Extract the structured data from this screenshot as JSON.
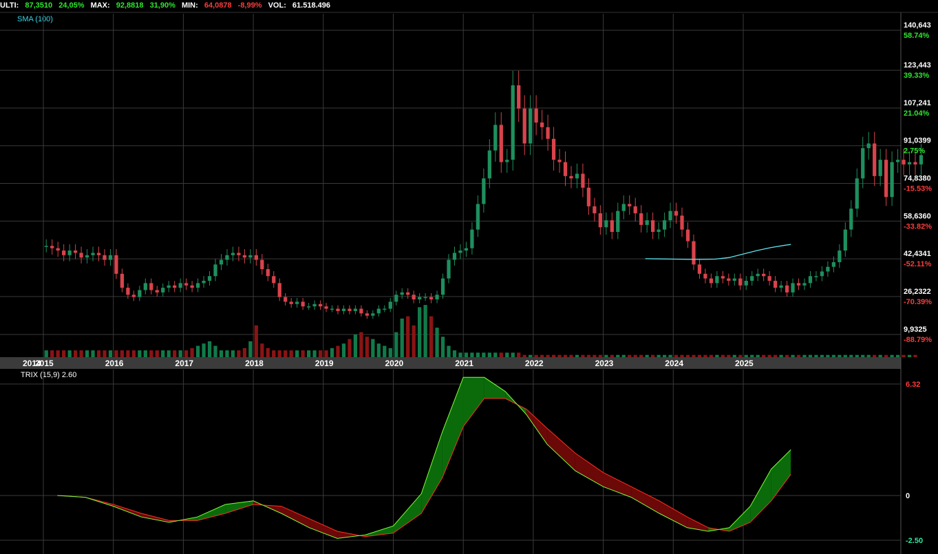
{
  "header": {
    "last_label": "ULTI:",
    "last_value": "87,3510",
    "last_pct": "24,05%",
    "max_label": "MAX:",
    "max_value": "92,8818",
    "max_pct": "31,90%",
    "min_label": "MIN:",
    "min_value": "64,0878",
    "min_pct": "-8,99%",
    "vol_label": "VOL:",
    "vol_value": "61.518.496"
  },
  "sma_label": "SMA (100)",
  "trix_label": "TRIX (15,9) 2.60",
  "colors": {
    "up": "#1e8f5e",
    "down": "#d9434b",
    "sma": "#5fe4f0",
    "trix": "#7dff3a",
    "signal": "#ff3020",
    "fill_up": "#0b6b0b",
    "fill_down": "#6b0808",
    "grid": "#3a3a3a"
  },
  "chart_data": [
    {
      "type": "candlestick",
      "title": "",
      "y_axis": {
        "ticks": [
          "140,643",
          "123,443",
          "107,241",
          "91,0399",
          "74,8380",
          "58,6360",
          "42,4341",
          "26,2322",
          "9,9325"
        ],
        "tick_values": [
          140.643,
          123.443,
          107.241,
          91.0399,
          74.838,
          58.636,
          42.4341,
          26.2322,
          9.9325
        ],
        "pct_labels": [
          "58.74%",
          "39.33%",
          "21.04%",
          "2.75%",
          "-15.53%",
          "-33.82%",
          "-52.11%",
          "-70.39%",
          "-88.79%"
        ],
        "range": [
          0,
          146
        ]
      },
      "x_axis": {
        "labels": [
          "2014",
          "2015",
          "2016",
          "2017",
          "2018",
          "2019",
          "2020",
          "2021",
          "2022",
          "2023",
          "2024",
          "2025"
        ],
        "range": [
          2014.8,
          2025.8
        ]
      },
      "grid": true,
      "x_start": 2015.0,
      "step_months": 1,
      "close": [
        48,
        47,
        46,
        44,
        46,
        45,
        43,
        44,
        45,
        44,
        42,
        44,
        36,
        30,
        27,
        26,
        29,
        32,
        29,
        28,
        30,
        31,
        30,
        32,
        31,
        30,
        32,
        33,
        35,
        40,
        42,
        44,
        45,
        44,
        43,
        44,
        42,
        38,
        35,
        32,
        26,
        24,
        23,
        24,
        22,
        22,
        23,
        22,
        21,
        21,
        20,
        21,
        20,
        21,
        19,
        18,
        19,
        21,
        21,
        24,
        27,
        28,
        27,
        25,
        26,
        26,
        25,
        27,
        34,
        42,
        45,
        46,
        47,
        55,
        66,
        77,
        89,
        100,
        84,
        85,
        117,
        107,
        92,
        107,
        101,
        99,
        94,
        85,
        84,
        78,
        77,
        79,
        73,
        65,
        62,
        56,
        59,
        54,
        63,
        66,
        65,
        62,
        57,
        59,
        54,
        55,
        59,
        63,
        61,
        55,
        50,
        40,
        36,
        34,
        32,
        35,
        34,
        33,
        34,
        31,
        33,
        35,
        36,
        35,
        33,
        30,
        31,
        28,
        32,
        31,
        32,
        35,
        35,
        37,
        39,
        41,
        46,
        55,
        64,
        77,
        90,
        92,
        78,
        85,
        69,
        84,
        85,
        83,
        84,
        83,
        87
      ],
      "volume": [
        3,
        3,
        3,
        3,
        3,
        3,
        3,
        3,
        3,
        3,
        3,
        3,
        3,
        3,
        3,
        3,
        3,
        3,
        3,
        3,
        3,
        3,
        3,
        3,
        3,
        4,
        5,
        6,
        7,
        5,
        3,
        3,
        3,
        3,
        4,
        7,
        14,
        6,
        4,
        3,
        3,
        3,
        3,
        3,
        3,
        3,
        3,
        3,
        3,
        4,
        5,
        6,
        8,
        10,
        11,
        9,
        8,
        6,
        5,
        4,
        11,
        17,
        18,
        14,
        22,
        23,
        18,
        13,
        9,
        5,
        3,
        2,
        2,
        2,
        2,
        2,
        2,
        2,
        2,
        2,
        2,
        2,
        1,
        1,
        1,
        1,
        1,
        1,
        1,
        1,
        1,
        1,
        1,
        1,
        1,
        1,
        1,
        1,
        1,
        1,
        1,
        1,
        1,
        1,
        1,
        1,
        1,
        1,
        1,
        1,
        1,
        1,
        1,
        1,
        1,
        1,
        1,
        1,
        1,
        1,
        1,
        1,
        1,
        1,
        1,
        1,
        1,
        1,
        1,
        1,
        1,
        1,
        1,
        1,
        1,
        1,
        1,
        1,
        1,
        1,
        1,
        1,
        1,
        1,
        1,
        1,
        1,
        1,
        1,
        1
      ],
      "sma": [
        [
          2023.6,
          42.5
        ],
        [
          2023.8,
          42.4
        ],
        [
          2024.0,
          42.3
        ],
        [
          2024.2,
          42.2
        ],
        [
          2024.4,
          42.2
        ],
        [
          2024.6,
          42.3
        ],
        [
          2024.8,
          43.0
        ],
        [
          2025.0,
          44.5
        ],
        [
          2025.2,
          46.0
        ],
        [
          2025.4,
          47.3
        ],
        [
          2025.6,
          48.3
        ],
        [
          2025.68,
          48.6
        ]
      ]
    },
    {
      "type": "line",
      "title": "",
      "y_axis": {
        "ticks": [
          "6.32",
          "0",
          "-2.50"
        ],
        "tick_values": [
          6.32,
          0,
          -2.5
        ],
        "range": [
          -2.9,
          6.9
        ]
      },
      "series": [
        {
          "name": "",
          "x": [
            2015.2,
            2015.6,
            2016.0,
            2016.4,
            2016.8,
            2017.2,
            2017.6,
            2018.0,
            2018.4,
            2018.8,
            2019.2,
            2019.6,
            2020.0,
            2020.4,
            2020.7,
            2021.0,
            2021.3,
            2021.6,
            2021.9,
            2022.2,
            2022.6,
            2023.0,
            2023.4,
            2023.8,
            2024.2,
            2024.5,
            2024.8,
            2025.1,
            2025.4,
            2025.68
          ],
          "values": [
            0,
            -0.1,
            -0.6,
            -1.2,
            -1.5,
            -1.2,
            -0.5,
            -0.3,
            -1.0,
            -1.8,
            -2.4,
            -2.2,
            -1.7,
            0.1,
            3.6,
            6.7,
            6.7,
            5.9,
            4.6,
            2.9,
            1.4,
            0.5,
            -0.1,
            -1.0,
            -1.8,
            -2.0,
            -1.8,
            -0.6,
            1.5,
            2.6
          ]
        },
        {
          "name": "",
          "x": [
            2015.2,
            2015.6,
            2016.0,
            2016.4,
            2016.8,
            2017.2,
            2017.6,
            2018.0,
            2018.4,
            2018.8,
            2019.2,
            2019.6,
            2020.0,
            2020.4,
            2020.7,
            2021.0,
            2021.3,
            2021.6,
            2021.9,
            2022.2,
            2022.6,
            2023.0,
            2023.4,
            2023.8,
            2024.2,
            2024.5,
            2024.8,
            2025.1,
            2025.4,
            2025.68
          ],
          "values": [
            0,
            -0.1,
            -0.5,
            -1.0,
            -1.4,
            -1.4,
            -1.0,
            -0.5,
            -0.6,
            -1.3,
            -2.0,
            -2.3,
            -2.1,
            -1.0,
            1.0,
            3.9,
            5.5,
            5.5,
            4.9,
            3.8,
            2.4,
            1.3,
            0.5,
            -0.3,
            -1.2,
            -1.8,
            -2.0,
            -1.5,
            -0.3,
            1.2
          ]
        }
      ]
    }
  ]
}
